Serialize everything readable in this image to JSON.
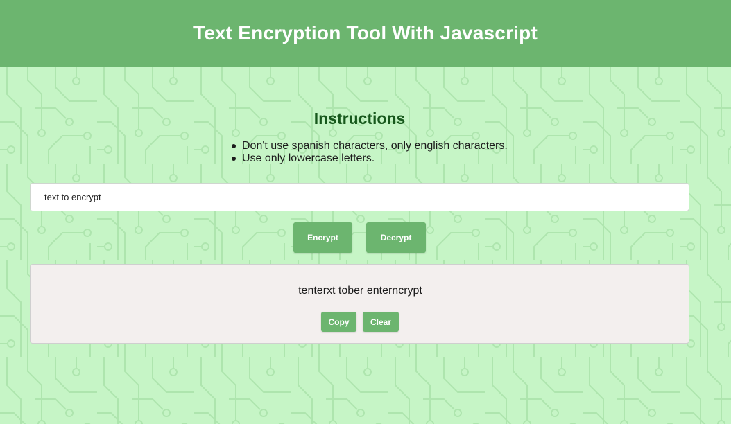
{
  "header": {
    "title": "Text Encryption Tool With Javascript"
  },
  "instructions": {
    "title": "Instructions",
    "items": [
      "Don't use spanish characters, only english characters.",
      "Use only lowercase letters."
    ]
  },
  "input": {
    "value": "text to encrypt",
    "placeholder": ""
  },
  "buttons": {
    "encrypt_label": "Encrypt",
    "decrypt_label": "Decrypt"
  },
  "result": {
    "text": "tenterxt tober enterncrypt",
    "copy_label": "Copy",
    "clear_label": "Clear"
  },
  "colors": {
    "header_bg": "#6cb56f",
    "page_bg": "#c6f5c6",
    "title_green": "#17581c",
    "button_bg": "#6cb56f",
    "result_bg": "#f3efee"
  },
  "icons": {
    "background_pattern": "circuit-board-pattern"
  }
}
